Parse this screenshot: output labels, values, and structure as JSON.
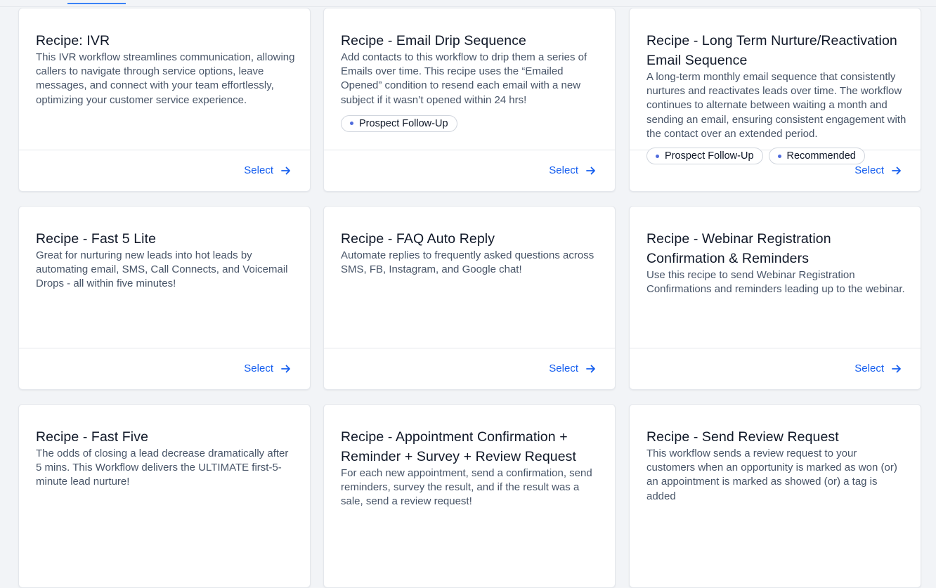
{
  "accent_color": "#155eef",
  "cards": [
    {
      "title": "Recipe: IVR",
      "description": "This IVR workflow streamlines communication, allowing callers to navigate through service options, leave messages, and connect with your team effortlessly, optimizing your customer service experience.",
      "tags": [],
      "select_label": "Select"
    },
    {
      "title": "Recipe - Email Drip Sequence",
      "description": "Add contacts to this workflow to drip them a series of Emails over time. This recipe uses the “Emailed Opened” condition to resend each email with a new subject if it wasn’t opened within 24 hrs!",
      "tags": [
        "Prospect Follow-Up"
      ],
      "select_label": "Select"
    },
    {
      "title": "Recipe - Long Term Nurture/Reactivation Email Sequence",
      "description": "A long-term monthly email sequence that consistently nurtures and reactivates leads over time. The workflow continues to alternate between waiting a month and sending an email, ensuring consistent engagement with the contact over an extended period.",
      "tags": [
        "Prospect Follow-Up",
        "Recommended"
      ],
      "select_label": "Select"
    },
    {
      "title": "Recipe - Fast 5 Lite",
      "description": "Great for nurturing new leads into hot leads by automating email, SMS, Call Connects, and Voicemail Drops - all within five minutes!",
      "tags": [],
      "select_label": "Select"
    },
    {
      "title": "Recipe - FAQ Auto Reply",
      "description": "Automate replies to frequently asked questions across SMS, FB, Instagram, and Google chat!",
      "tags": [],
      "select_label": "Select"
    },
    {
      "title": "Recipe - Webinar Registration Confirmation & Reminders",
      "description": "Use this recipe to send Webinar Registration Confirmations and reminders leading up to the webinar.",
      "tags": [],
      "select_label": "Select"
    },
    {
      "title": "Recipe - Fast Five",
      "description": "The odds of closing a lead decrease dramatically after 5 mins. This Workflow delivers the ULTIMATE first-5-minute lead nurture!",
      "tags": [],
      "select_label": ""
    },
    {
      "title": "Recipe - Appointment Confirmation + Reminder + Survey + Review Request",
      "description": "For each new appointment, send a confirmation, send reminders, survey the result, and if the result was a sale, send a review request!",
      "tags": [],
      "select_label": ""
    },
    {
      "title": "Recipe - Send Review Request",
      "description": "This workflow sends a review request to your customers when an opportunity is marked as won (or) an appointment is marked as showed (or) a tag is added",
      "tags": [],
      "select_label": ""
    }
  ]
}
